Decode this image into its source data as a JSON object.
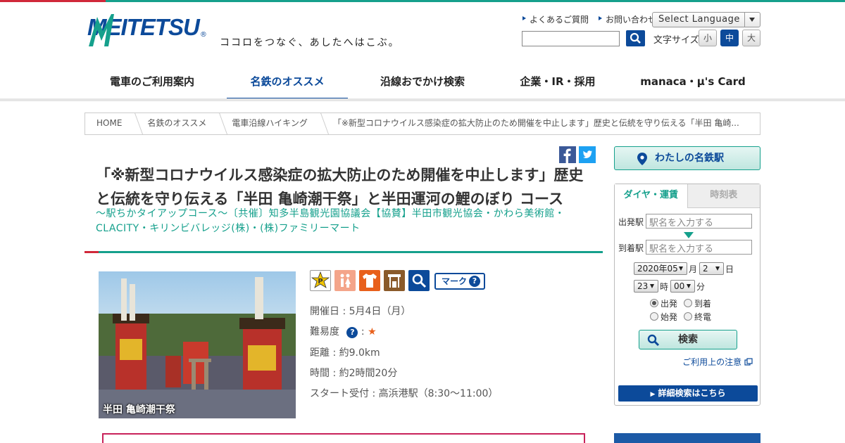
{
  "header": {
    "logo_text": "MEITETSU",
    "logo_reg": "®",
    "tagline": "ココロをつなぐ、あしたへはこぶ。",
    "links": [
      "よくあるご質問",
      "お問い合わせ"
    ],
    "language": "Select Language",
    "font_size_label": "文字サイズ",
    "font_sizes": [
      "小",
      "中",
      "大"
    ],
    "colors": {
      "brand_blue": "#0c4a9a",
      "accent_green": "#15a08c",
      "accent_red": "#d0283a"
    }
  },
  "nav": [
    "電車のご利用案内",
    "名鉄のオススメ",
    "沿線おでかけ検索",
    "企業・IR・採用",
    "manaca・μ's Card"
  ],
  "breadcrumb": [
    "HOME",
    "名鉄のオススメ",
    "電車沿線ハイキング",
    "「※新型コロナウイルス感染症の拡大防止のため開催を中止します」歴史と伝統を守り伝える「半田 亀崎..."
  ],
  "article": {
    "title": "「※新型コロナウイルス感染症の拡大防止のため開催を中止します」歴史と伝統を守り伝える「半田 亀崎潮干祭」と半田運河の鯉のぼり コース",
    "subtitle": "～駅ちかタイアップコース～〔共催〕知多半島観光園協議会【協賛】半田市観光協会・かわら美術館・CLACITY・キリンビバレッジ(株)・(株)ファミリーマート",
    "photo_caption": "半田 亀崎潮干祭",
    "icons": [
      "P",
      "toilet-icon",
      "shirt-icon",
      "shop-icon",
      "search-icon"
    ],
    "mark_label": "マーク",
    "date": "開催日 : 5月4日（月）",
    "difficulty_label": "難易度",
    "difficulty_sep": ":",
    "difficulty_star": "★",
    "distance": "距離 : 約9.0km",
    "time": "時間 : 約2時間20分",
    "start": "スタート受付 : 高浜港駅（8:30～11:00）"
  },
  "sidebar": {
    "my_station": "わたしの名鉄駅",
    "tabs": [
      "ダイヤ・運賃",
      "時刻表"
    ],
    "from_label": "出発駅",
    "to_label": "到着駅",
    "from_placeholder": "駅名を入力する",
    "to_placeholder": "駅名を入力する",
    "year_month": "2020年05",
    "month_unit": "月",
    "day": "2",
    "day_unit": "日",
    "hour": "23",
    "hour_unit": "時",
    "minute": "00",
    "minute_unit": "分",
    "radios": [
      "出発",
      "到着",
      "始発",
      "終電"
    ],
    "search_label": "検索",
    "notice": "ご利用上の注意",
    "detail": "詳細検索はこちら"
  }
}
